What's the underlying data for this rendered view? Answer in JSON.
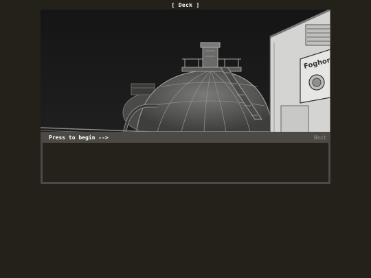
{
  "header": {
    "location_title": "[ Deck ]"
  },
  "scene": {
    "description_icon": "industrial-dome-tank-scene",
    "sign_text": "Foghorn"
  },
  "dialog": {
    "prompt": "Press to begin -->",
    "next_label": "Next",
    "body_text": ""
  },
  "colors": {
    "background": "#24211b",
    "dialog_frame": "#4d4a46",
    "dialog_inner": "#25221b",
    "text_primary": "#ffffff",
    "text_muted": "#8c8984"
  }
}
